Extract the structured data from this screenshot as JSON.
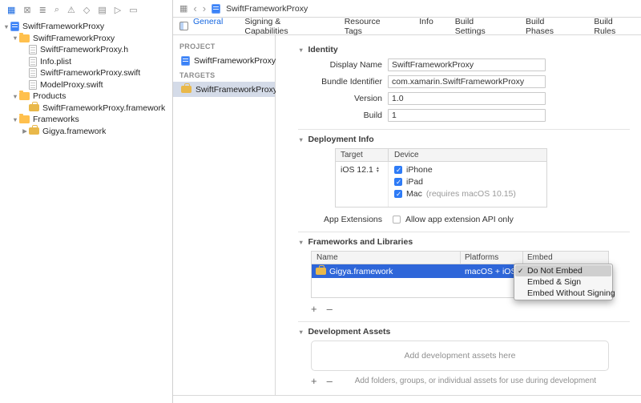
{
  "navigator_bar": {
    "icons": [
      "project-navigator-icon",
      "source-control-navigator-icon",
      "symbol-navigator-icon",
      "find-navigator-icon",
      "issue-navigator-icon",
      "test-navigator-icon",
      "debug-navigator-icon",
      "breakpoint-navigator-icon",
      "report-navigator-icon"
    ]
  },
  "file_navigator": {
    "items": [
      {
        "label": "SwiftFrameworkProxy",
        "type": "project",
        "level": 0,
        "expanded": true
      },
      {
        "label": "SwiftFrameworkProxy",
        "type": "folder",
        "level": 1,
        "expanded": true
      },
      {
        "label": "SwiftFrameworkProxy.h",
        "type": "header-file",
        "level": 2
      },
      {
        "label": "Info.plist",
        "type": "plist-file",
        "level": 2
      },
      {
        "label": "SwiftFrameworkProxy.swift",
        "type": "swift-file",
        "level": 2
      },
      {
        "label": "ModelProxy.swift",
        "type": "swift-file",
        "level": 2
      },
      {
        "label": "Products",
        "type": "folder",
        "level": 1,
        "expanded": true
      },
      {
        "label": "SwiftFrameworkProxy.framework",
        "type": "framework",
        "level": 2
      },
      {
        "label": "Frameworks",
        "type": "folder",
        "level": 1,
        "expanded": true
      },
      {
        "label": "Gigya.framework",
        "type": "framework",
        "level": 2,
        "expanded": false
      }
    ]
  },
  "jump_bar": {
    "title": "SwiftFrameworkProxy"
  },
  "tabs": [
    {
      "label": "General",
      "selected": true
    },
    {
      "label": "Signing & Capabilities",
      "selected": false
    },
    {
      "label": "Resource Tags",
      "selected": false
    },
    {
      "label": "Info",
      "selected": false
    },
    {
      "label": "Build Settings",
      "selected": false
    },
    {
      "label": "Build Phases",
      "selected": false
    },
    {
      "label": "Build Rules",
      "selected": false
    }
  ],
  "project_panel": {
    "project_header": "PROJECT",
    "project_item": "SwiftFrameworkProxy",
    "targets_header": "TARGETS",
    "target_item": "SwiftFrameworkProxy",
    "target_selected": true
  },
  "identity": {
    "title": "Identity",
    "fields": [
      {
        "label": "Display Name",
        "value": "SwiftFrameworkProxy"
      },
      {
        "label": "Bundle Identifier",
        "value": "com.xamarin.SwiftFrameworkProxy"
      },
      {
        "label": "Version",
        "value": "1.0"
      },
      {
        "label": "Build",
        "value": "1"
      }
    ]
  },
  "deployment": {
    "title": "Deployment Info",
    "target_column": "Target",
    "device_column": "Device",
    "target_value": "iOS 12.1",
    "devices": [
      {
        "label": "iPhone",
        "checked": true,
        "note": ""
      },
      {
        "label": "iPad",
        "checked": true,
        "note": ""
      },
      {
        "label": "Mac",
        "checked": true,
        "note": "(requires macOS 10.15)"
      }
    ],
    "app_extensions_label": "App Extensions",
    "app_extensions_option": "Allow app extension API only",
    "app_extensions_checked": false
  },
  "frameworks": {
    "title": "Frameworks and Libraries",
    "columns": {
      "name": "Name",
      "platforms": "Platforms",
      "embed": "Embed"
    },
    "rows": [
      {
        "name": "Gigya.framework",
        "platforms": "macOS + iOS",
        "selected": true
      }
    ],
    "embed_menu": {
      "options": [
        {
          "label": "Do Not Embed",
          "checked": true,
          "highlighted": true
        },
        {
          "label": "Embed & Sign",
          "checked": false,
          "highlighted": false
        },
        {
          "label": "Embed Without Signing",
          "checked": false,
          "highlighted": false
        }
      ]
    }
  },
  "development_assets": {
    "title": "Development Assets",
    "empty_text": "Add development assets here",
    "hint": "Add folders, groups, or individual assets for use during development"
  },
  "controls": {
    "add": "+",
    "remove": "–"
  },
  "colors": {
    "accent_blue": "#1667e0",
    "row_selection_blue": "#2e66d9",
    "target_selection": "#d4dbe8",
    "folder_yellow": "#ffc04d"
  }
}
